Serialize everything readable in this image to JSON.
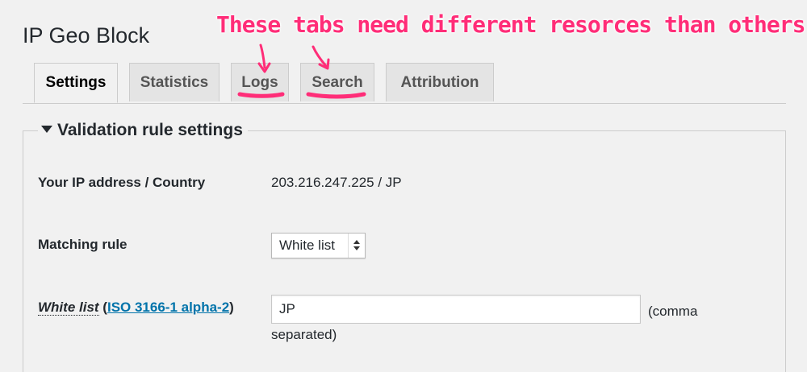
{
  "page": {
    "title": "IP Geo Block"
  },
  "annotation": {
    "text": "These tabs need different resorces than others",
    "color": "#ff2d78"
  },
  "tabs": [
    {
      "label": "Settings",
      "active": true
    },
    {
      "label": "Statistics",
      "active": false
    },
    {
      "label": "Logs",
      "active": false
    },
    {
      "label": "Search",
      "active": false
    },
    {
      "label": "Attribution",
      "active": false
    }
  ],
  "section": {
    "title": "Validation rule settings",
    "toggle_icon": "triangle-down-icon"
  },
  "rows": {
    "ip": {
      "label": "Your IP address / Country",
      "value": "203.216.247.225 / JP"
    },
    "matching_rule": {
      "label": "Matching rule",
      "selected": "White list"
    },
    "white_list": {
      "label": "White list",
      "paren_open": "(",
      "link": "ISO 3166-1 alpha-2",
      "paren_close": ")",
      "value": "JP",
      "hint_line1": "(comma",
      "hint_line2": "separated)"
    }
  },
  "colors": {
    "link": "#0073aa",
    "background": "#f1f1f1"
  }
}
